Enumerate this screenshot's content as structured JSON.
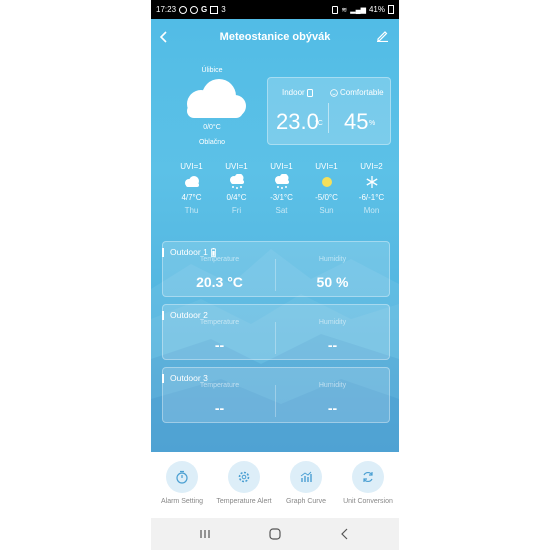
{
  "status_bar": {
    "time": "17:23",
    "status_icons": [
      "G",
      "3"
    ],
    "battery": "41%"
  },
  "header": {
    "title": "Meteostanice obývák",
    "back_icon": "chevron-left-icon",
    "edit_icon": "pencil-icon"
  },
  "current": {
    "location": "Úlibice",
    "temp_range": "0/0°C",
    "condition": "Oblačno",
    "icon": "cloud-icon"
  },
  "indoor": {
    "label": "Indoor",
    "comfort_label": "Comfortable",
    "temperature": "23.0",
    "temperature_unit": "°C",
    "humidity": "45",
    "humidity_unit": "%"
  },
  "forecast": [
    {
      "uvi": "UVI=1",
      "range": "4/7°C",
      "day": "Thu",
      "icon": "cloud-icon"
    },
    {
      "uvi": "UVI=1",
      "range": "0/4°C",
      "day": "Fri",
      "icon": "snow-cloud-icon"
    },
    {
      "uvi": "UVI=1",
      "range": "-3/1°C",
      "day": "Sat",
      "icon": "snow-cloud-icon"
    },
    {
      "uvi": "UVI=1",
      "range": "-5/0°C",
      "day": "Sun",
      "icon": "sun-icon"
    },
    {
      "uvi": "UVI=2",
      "range": "-6/-1°C",
      "day": "Mon",
      "icon": "snowflake-icon"
    }
  ],
  "outdoor": [
    {
      "name": "Outdoor 1",
      "temp_label": "Temperature",
      "hum_label": "Humidity",
      "temperature": "20.3 °C",
      "humidity": "50 %"
    },
    {
      "name": "Outdoor 2",
      "temp_label": "Temperature",
      "hum_label": "Humidity",
      "temperature": "--",
      "humidity": "--"
    },
    {
      "name": "Outdoor 3",
      "temp_label": "Temperature",
      "hum_label": "Humidity",
      "temperature": "--",
      "humidity": "--"
    }
  ],
  "bottom_menu": [
    {
      "label": "Alarm Setting",
      "icon": "timer-icon"
    },
    {
      "label": "Temperature Alert",
      "icon": "gear-icon"
    },
    {
      "label": "Graph Curve",
      "icon": "chart-icon"
    },
    {
      "label": "Unit Conversion",
      "icon": "refresh-icon"
    }
  ],
  "colors": {
    "accent": "#52bce6",
    "menu_circle": "#ddeef8",
    "sun": "#f5e05a"
  }
}
